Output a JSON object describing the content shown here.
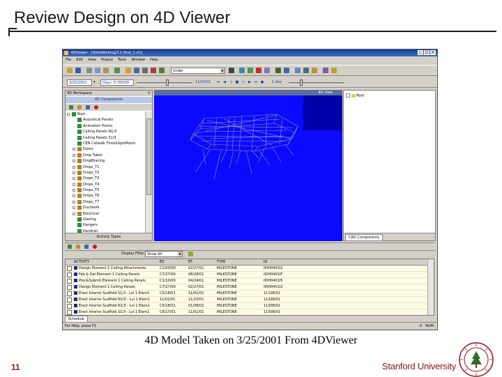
{
  "slide": {
    "title": "Review Design on 4D Viewer",
    "caption": "4D Model Taken on 3/25/2001 From 4DViewer",
    "page_number": "11",
    "institution": "Stanford University"
  },
  "app": {
    "window_title": "4DViewer - [HelloWorking/3.1-final_2.vlv]",
    "menus": [
      "File",
      "Edit",
      "View",
      "Project",
      "Tools",
      "Window",
      "Help"
    ],
    "layer_combo": "Under",
    "date_field": "3/25/2001",
    "days_label": "Days: 0.783/00",
    "current_date": "11/25/01",
    "step_label": "1 day",
    "left_pane_title": "4D Workspace",
    "components_title": "4D Components",
    "tree_items": [
      {
        "label": "Root",
        "level": 0,
        "expander": "-",
        "icon": "green"
      },
      {
        "label": "Acoustical Panels",
        "level": 1,
        "expander": "",
        "icon": "green"
      },
      {
        "label": "Animation Points",
        "level": 1,
        "expander": "",
        "icon": "green"
      },
      {
        "label": "Ceiling Panels N1/3",
        "level": 1,
        "expander": "",
        "icon": "green"
      },
      {
        "label": "Ceiling Panels S1/3",
        "level": 1,
        "expander": "",
        "icon": "green"
      },
      {
        "label": "CEN Catwalk Floor&SpotRoom",
        "level": 1,
        "expander": "",
        "icon": "green"
      },
      {
        "label": "Doors",
        "level": 1,
        "expander": "+",
        "icon": "box"
      },
      {
        "label": "Drop Tubes",
        "level": 1,
        "expander": "+",
        "icon": "box"
      },
      {
        "label": "DropBracing",
        "level": 1,
        "expander": "+",
        "icon": "box"
      },
      {
        "label": "Drops_T1",
        "level": 1,
        "expander": "+",
        "icon": "box"
      },
      {
        "label": "Drops_T2",
        "level": 1,
        "expander": "+",
        "icon": "box"
      },
      {
        "label": "Drops_T3",
        "level": 1,
        "expander": "+",
        "icon": "box"
      },
      {
        "label": "Drops_T4",
        "level": 1,
        "expander": "+",
        "icon": "box"
      },
      {
        "label": "Drops_T5",
        "level": 1,
        "expander": "+",
        "icon": "box"
      },
      {
        "label": "Drops_T6",
        "level": 1,
        "expander": "+",
        "icon": "box"
      },
      {
        "label": "Drops_T7",
        "level": 1,
        "expander": "+",
        "icon": "box"
      },
      {
        "label": "Ductwork",
        "level": 1,
        "expander": "+",
        "icon": "box"
      },
      {
        "label": "Electrical",
        "level": 1,
        "expander": "+",
        "icon": "box"
      },
      {
        "label": "Glazing",
        "level": 1,
        "expander": "",
        "icon": "green"
      },
      {
        "label": "Hangers",
        "level": 1,
        "expander": "",
        "icon": "green"
      },
      {
        "label": "Handrail",
        "level": 1,
        "expander": "",
        "icon": "green"
      }
    ],
    "left_bottom_tab": "Activity Types",
    "viewer_title": "4D View",
    "right_tree_root": "Root",
    "right_tab": "CAD Components",
    "display_filter_label": "Display Filter:",
    "display_filter_value": "Show All",
    "grid_columns": [
      "ACTIVITY",
      "ES",
      "EF",
      "TYPE",
      "ID"
    ],
    "grid_rows": [
      {
        "activity": "Design Element 1 Ceiling Attachments",
        "es": "C1/03/00",
        "ef": "02/27/01",
        "type": "MILESTONE",
        "id": "00H0401I2"
      },
      {
        "activity": "Fab & Del Element 1 Ceiling Panels",
        "es": "C7/27/00",
        "ef": "08/28/01",
        "type": "MILESTONE",
        "id": "00H0401IF"
      },
      {
        "activity": "Proc&Submit Element 1 Ceiling Panels",
        "es": "C1/10/00",
        "ef": "04/24/01",
        "type": "MILESTONE",
        "id": "00H0401I5"
      },
      {
        "activity": "Design Element 1 Ceiling Panels",
        "es": "C7/27/00",
        "ef": "02/27/01",
        "type": "MILESTONE",
        "id": "00H0401I2"
      },
      {
        "activity": "Erect Interior Scaffold S1/3 - Lvl 1 Elem1",
        "es": "C5/18/01",
        "ef": "11/01/01",
        "type": "MILESTONE",
        "id": "11108/01"
      },
      {
        "activity": "Erect Interior Scaffold N1/3 - Lvl 1 Elem1",
        "es": "11/02/01",
        "ef": "11/15/01",
        "type": "MILESTONE",
        "id": "11208/01"
      },
      {
        "activity": "Erect Interior Scaffold N1/3 - Lvl 1 Elem1",
        "es": "C5/18/01",
        "ef": "01/08/02",
        "type": "MILESTONE",
        "id": "11308/01"
      },
      {
        "activity": "Erect Interior Scaffold S1/3 - Lvl 1 Elem1",
        "es": "C6/17/01",
        "ef": "11/01/01",
        "type": "MILESTONE",
        "id": "11508/01"
      }
    ],
    "schedule_tab": "Schedule",
    "status_text": "For Help, press F1",
    "status_num": "0",
    "status_mode": "NUM"
  },
  "colors": {
    "university_red": "#8c1515",
    "viewer_blue": "#0a0aff",
    "titlebar_blue": "#1c3f94"
  }
}
